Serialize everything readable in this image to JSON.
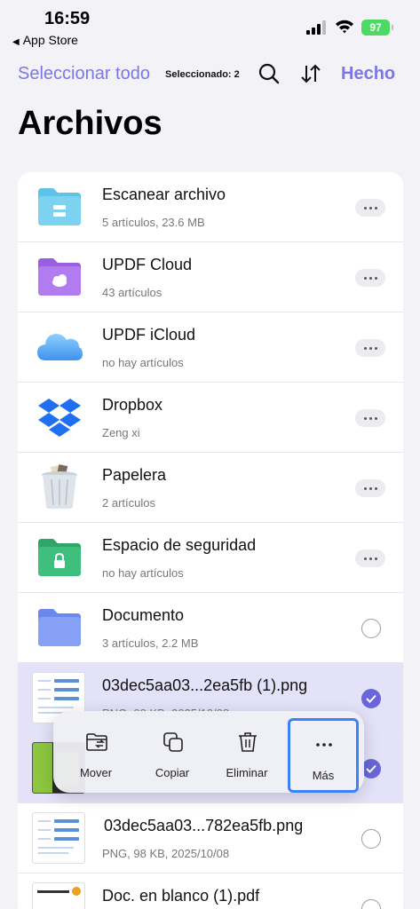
{
  "status_bar": {
    "time": "16:59",
    "back_app": "App Store",
    "battery": "97"
  },
  "nav": {
    "select_all": "Seleccionar todo",
    "selected_count": "Seleccionado: 2",
    "done": "Hecho"
  },
  "page_title": "Archivos",
  "rows": [
    {
      "name": "Escanear archivo",
      "meta": "5 artículos, 23.6 MB",
      "icon": "scan-folder-icon"
    },
    {
      "name": "UPDF Cloud",
      "meta": "43 artículos",
      "icon": "cloud-folder-icon"
    },
    {
      "name": "UPDF iCloud",
      "meta": "no hay artículos",
      "icon": "icloud-icon"
    },
    {
      "name": "Dropbox",
      "meta": "Zeng xi",
      "icon": "dropbox-icon"
    },
    {
      "name": "Papelera",
      "meta": "2 artículos",
      "icon": "trash-bin-icon"
    },
    {
      "name": "Espacio de seguridad",
      "meta": "no hay artículos",
      "icon": "lock-folder-icon"
    },
    {
      "name": "Documento",
      "meta": "3 artículos, 2.2 MB",
      "icon": "folder-icon"
    },
    {
      "name": "03dec5aa03...2ea5fb (1).png",
      "meta": "PNG, 98 KB, 2025/10/08",
      "icon": "png-thumbnail",
      "selected": true
    },
    {
      "name": "",
      "meta": "",
      "icon": "image-thumbnail",
      "selected": true
    },
    {
      "name": "03dec5aa03...782ea5fb.png",
      "meta": "PNG, 98 KB, 2025/10/08",
      "icon": "png-thumbnail"
    },
    {
      "name": "Doc. en blanco (1).pdf",
      "meta": "",
      "icon": "pdf-thumbnail"
    }
  ],
  "actions": [
    {
      "label": "Mover",
      "icon": "move-folder-icon"
    },
    {
      "label": "Copiar",
      "icon": "copy-icon"
    },
    {
      "label": "Eliminar",
      "icon": "trash-icon"
    },
    {
      "label": "Más",
      "icon": "ellipsis-icon"
    }
  ],
  "colors": {
    "accent": "#7b77e8",
    "selected_row": "#e3e2f8",
    "highlight_border": "#3b82f6"
  }
}
